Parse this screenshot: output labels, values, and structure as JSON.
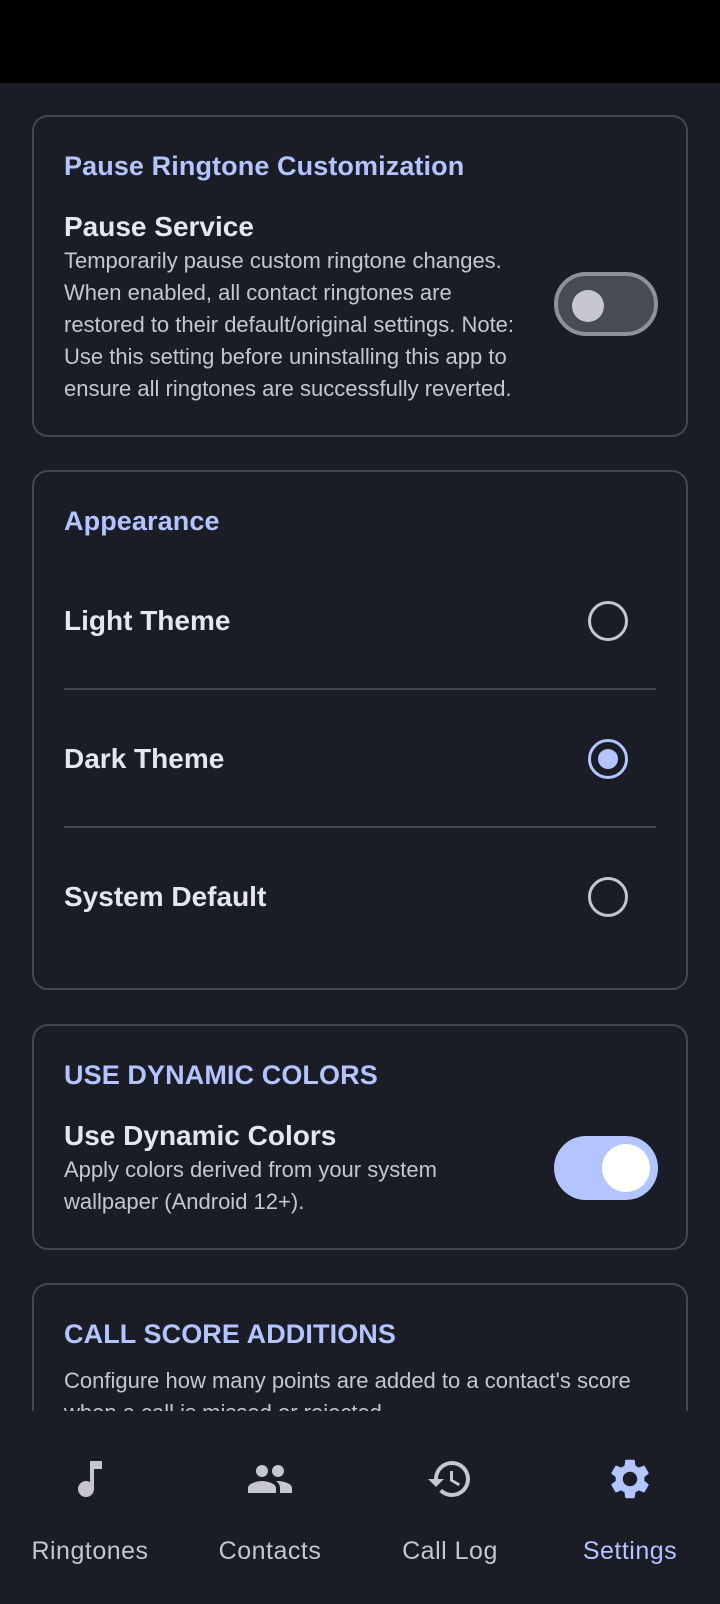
{
  "pause_section": {
    "title": "Pause Ringtone Customization",
    "item_title": "Pause Service",
    "description": "Temporarily pause custom ringtone changes. When enabled, all contact ringtones are restored to their default/original settings. Note: Use this setting before uninstalling this app to ensure all ringtones are successfully reverted.",
    "toggle_on": false
  },
  "appearance": {
    "title": "Appearance",
    "options": [
      {
        "label": "Light Theme",
        "selected": false
      },
      {
        "label": "Dark Theme",
        "selected": true
      },
      {
        "label": "System Default",
        "selected": false
      }
    ]
  },
  "dynamic_colors": {
    "title": "USE DYNAMIC COLORS",
    "item_title": "Use Dynamic Colors",
    "description": "Apply colors derived from your system wallpaper (Android 12+).",
    "toggle_on": true
  },
  "call_score": {
    "title": "CALL SCORE ADDITIONS",
    "description": "Configure how many points are added to a contact's score when a call is missed or rejected."
  },
  "bottom_nav": {
    "items": [
      {
        "label": "Ringtones",
        "icon": "music-note-icon",
        "active": false
      },
      {
        "label": "Contacts",
        "icon": "people-icon",
        "active": false
      },
      {
        "label": "Call Log",
        "icon": "history-icon",
        "active": false
      },
      {
        "label": "Settings",
        "icon": "gear-icon",
        "active": true
      }
    ]
  },
  "colors": {
    "background": "#1a1c26",
    "accent": "#b3c4ff",
    "outline": "#44464f"
  }
}
